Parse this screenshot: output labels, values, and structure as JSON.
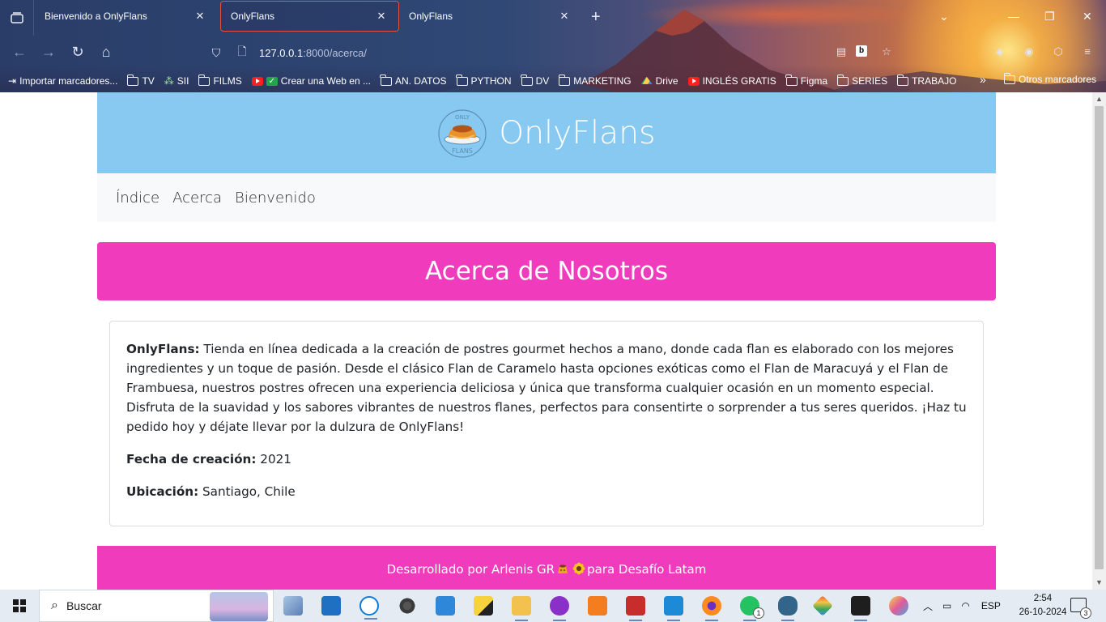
{
  "browser": {
    "tabs": [
      {
        "title": "Bienvenido a OnlyFlans",
        "active": false
      },
      {
        "title": "OnlyFlans",
        "active": true
      },
      {
        "title": "OnlyFlans",
        "active": false
      }
    ],
    "url_host": "127.0.0.1",
    "url_rest": ":8000/acerca/",
    "bookmarks": [
      {
        "label": "Importar marcadores...",
        "icon": "import-icon"
      },
      {
        "label": "TV",
        "icon": "folder-icon"
      },
      {
        "label": "SII",
        "icon": "sii-icon"
      },
      {
        "label": "FILMS",
        "icon": "folder-icon"
      },
      {
        "label": "Crear una Web en ...",
        "icon": "youtube-check-icon"
      },
      {
        "label": "AN. DATOS",
        "icon": "folder-icon"
      },
      {
        "label": "PYTHON",
        "icon": "folder-icon"
      },
      {
        "label": "DV",
        "icon": "folder-icon"
      },
      {
        "label": "MARKETING",
        "icon": "folder-icon"
      },
      {
        "label": "Drive",
        "icon": "drive-icon"
      },
      {
        "label": "INGLÉS GRATIS",
        "icon": "youtube-icon"
      },
      {
        "label": "Figma",
        "icon": "folder-icon"
      },
      {
        "label": "SERIES",
        "icon": "folder-icon"
      },
      {
        "label": "TRABAJO",
        "icon": "folder-icon"
      }
    ],
    "other_bookmarks": "Otros marcadores",
    "accent": "#e2523a"
  },
  "site": {
    "title": "OnlyFlans",
    "logo_text_top": "ONLY",
    "logo_text_bottom": "FLANS",
    "nav": [
      "Índice",
      "Acerca",
      "Bienvenido"
    ],
    "hero": "Acerca de Nosotros",
    "about": {
      "brand": "OnlyFlans:",
      "text": " Tienda en línea dedicada a la creación de postres gourmet hechos a mano, donde cada flan es elaborado con los mejores ingredientes y un toque de pasión. Desde el clásico Flan de Caramelo hasta opciones exóticas como el Flan de Maracuyá y el Flan de Frambuesa, nuestros postres ofrecen una experiencia deliciosa y única que transforma cualquier ocasión en un momento especial. Disfruta de la suavidad y los sabores vibrantes de nuestros flanes, perfectos para consentirte o sorprender a tus seres queridos. ¡Haz tu pedido hoy y déjate llevar por la dulzura de OnlyFlans!"
    },
    "created_label": "Fecha de creación:",
    "created_value": " 2021",
    "location_label": "Ubicación:",
    "location_value": " Santiago, Chile",
    "footer_prefix": "Desarrollado por Arlenis GR ",
    "footer_suffix": " para Desafío Latam",
    "colors": {
      "header": "#87c9f1",
      "hero": "#f03bbd",
      "nav_bg": "#f8f9fa"
    }
  },
  "taskbar": {
    "search_placeholder": "Buscar",
    "lang": "ESP",
    "time": "2:54",
    "date": "26-10-2024",
    "whatsapp_badge": "1",
    "notifications_badge": "3"
  }
}
